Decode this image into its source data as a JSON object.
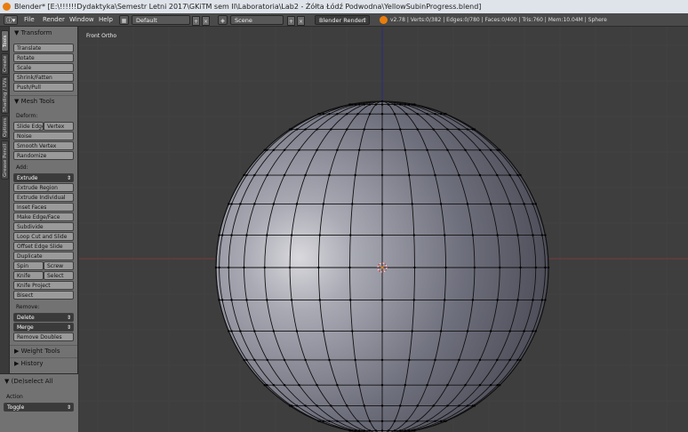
{
  "window": {
    "title": "Blender* [E:\\!!!!!!Dydaktyka\\Semestr Letni 2017\\GKiTM sem II\\Laboratoria\\Lab2 - Żółta Łódź Podwodna\\YellowSubinProgress.blend]"
  },
  "menubar": {
    "editor_icon": "info-icon",
    "menus": [
      "File",
      "Render",
      "Window",
      "Help"
    ],
    "layout": "Default",
    "scene": "Scene",
    "render_engine": "Blender Render",
    "stats": "v2.78 | Verts:0/382 | Edges:0/780 | Faces:0/400 | Tris:760 | Mem:10.04M | Sphere"
  },
  "tabs": [
    "Tools",
    "Create",
    "Shading / UVs",
    "Options",
    "Grease Pencil"
  ],
  "panel": {
    "transform_header": "Transform",
    "transform_buttons": [
      "Translate",
      "Rotate",
      "Scale",
      "Shrink/Fatten",
      "Push/Pull"
    ],
    "mesh_tools_header": "Mesh Tools",
    "deform_label": "Deform:",
    "slide_edge": "Slide Edge",
    "vertex": "Vertex",
    "deform_buttons": [
      "Noise",
      "Smooth Vertex",
      "Randomize"
    ],
    "add_label": "Add:",
    "extrude": "Extrude",
    "add_buttons": [
      "Extrude Region",
      "Extrude Individual",
      "Inset Faces",
      "Make Edge/Face",
      "Subdivide",
      "Loop Cut and Slide",
      "Offset Edge Slide",
      "Duplicate"
    ],
    "spin": "Spin",
    "screw": "Screw",
    "knife": "Knife",
    "select": "Select",
    "knife_project": "Knife Project",
    "bisect": "Bisect",
    "remove_label": "Remove:",
    "delete": "Delete",
    "merge": "Merge",
    "remove_doubles": "Remove Doubles",
    "weight_tools_header": "Weight Tools",
    "history_header": "History"
  },
  "operator": {
    "header": "(De)select All",
    "action_label": "Action",
    "action_value": "Toggle"
  },
  "viewport": {
    "label": "Front Ortho"
  },
  "colors": {
    "accent": "#e87d0d",
    "panel": "#727272",
    "viewport_bg": "#3e3e3e",
    "x_axis": "#7a3a3a",
    "z_axis": "#2a2a8a"
  }
}
